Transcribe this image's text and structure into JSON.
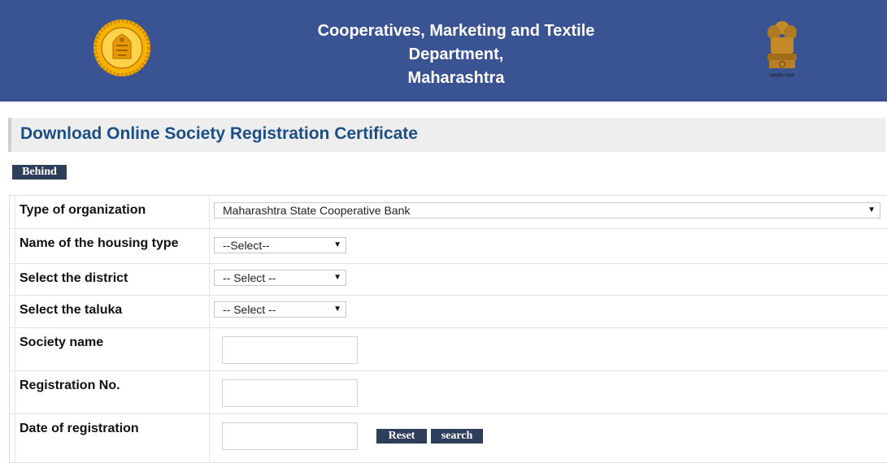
{
  "header": {
    "title_line1": "Cooperatives, Marketing and Textile",
    "title_line2": "Department,",
    "title_line3": "Maharashtra",
    "emblem_motto": "सत्यमेव जयते"
  },
  "page": {
    "title": "Download Online Society Registration Certificate"
  },
  "buttons": {
    "behind": "Behind",
    "reset": "Reset",
    "search": "search"
  },
  "form": {
    "organization_type": {
      "label": "Type of organization",
      "value": "Maharashtra State Cooperative Bank"
    },
    "housing_type": {
      "label": "Name of the housing type",
      "value": "--Select--"
    },
    "district": {
      "label": "Select the district",
      "value": "-- Select --"
    },
    "taluka": {
      "label": "Select the taluka",
      "value": "-- Select --"
    },
    "society_name": {
      "label": "Society name",
      "value": ""
    },
    "registration_no": {
      "label": "Registration No.",
      "value": ""
    },
    "registration_date": {
      "label": "Date of registration",
      "value": ""
    }
  },
  "colors": {
    "header_bg": "#3a5393",
    "title_text": "#1d4f86",
    "button_bg": "#2f3d5c"
  },
  "icons": {
    "left_logo": "maharashtra-seal-icon",
    "right_logo": "ashoka-emblem-icon",
    "dropdown_arrow": "triangle-down-icon"
  }
}
